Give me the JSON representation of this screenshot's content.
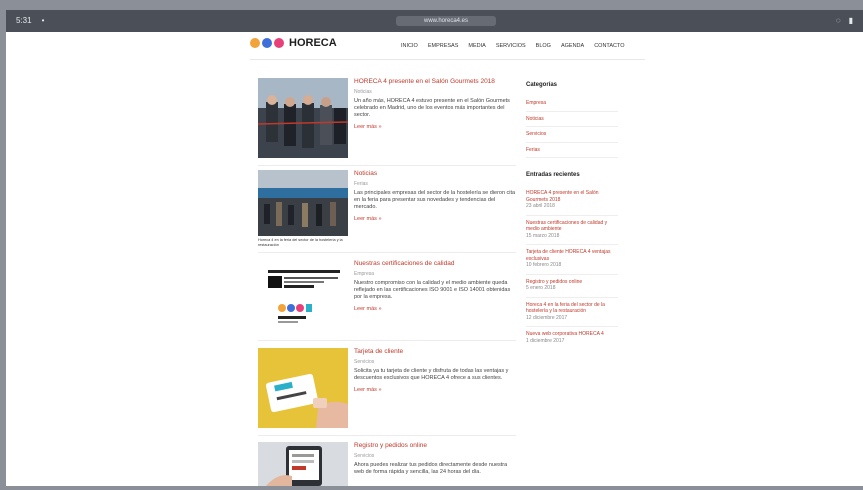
{
  "browser": {
    "left_labels": [
      "5:31",
      "•"
    ],
    "address": "www.horeca4.es",
    "right_icons": [
      "wifi-icon",
      "battery-icon"
    ]
  },
  "header": {
    "logo_text": "HORECA",
    "logo_sub": "",
    "nav": [
      "INICIO",
      "EMPRESAS",
      "MEDIA",
      "SERVICIOS",
      "BLOG",
      "AGENDA",
      "CONTACTO"
    ]
  },
  "articles": [
    {
      "title": "HORECA 4 presente en el Salón Gourmets 2018",
      "category": "Noticias",
      "text": "Un año más, HORECA 4 estuvo presente en el Salón Gourmets celebrado en Madrid, uno de los eventos más importantes del sector.",
      "more": "Leer más »",
      "caption": ""
    },
    {
      "title": "Noticias",
      "category": "Ferias",
      "text": "Las principales empresas del sector de la hostelería se dieron cita en la feria para presentar sus novedades y tendencias del mercado.",
      "more": "Leer más »",
      "caption": "Horeca 4 en la feria del sector de la hostelería y la restauración"
    },
    {
      "title": "Nuestras certificaciones de calidad",
      "category": "Empresa",
      "text": "Nuestro compromiso con la calidad y el medio ambiente queda reflejado en las certificaciones ISO 9001 e ISO 14001 obtenidas por la empresa.",
      "more": "Leer más »",
      "caption": ""
    },
    {
      "title": "Tarjeta de cliente",
      "category": "Servicios",
      "text": "Solicita ya tu tarjeta de cliente y disfruta de todas las ventajas y descuentos exclusivos que HORECA 4 ofrece a sus clientes.",
      "more": "Leer más »",
      "caption": ""
    },
    {
      "title": "Registro y pedidos online",
      "category": "Servicios",
      "text": "Ahora puedes realizar tus pedidos directamente desde nuestra web de forma rápida y sencilla, las 24 horas del día.",
      "more": "",
      "caption": ""
    }
  ],
  "sidebar": {
    "categories_title": "Categorías",
    "categories": [
      "Empresa",
      "Noticias",
      "Servicios",
      "Ferias"
    ],
    "recent_title": "Entradas recientes",
    "recent": [
      {
        "title": "HORECA 4 presente en el Salón Gourmets 2018",
        "date": "23 abril 2018"
      },
      {
        "title": "Nuestras certificaciones de calidad y medio ambiente",
        "date": "15 marzo 2018"
      },
      {
        "title": "Tarjeta de cliente HORECA 4 ventajas exclusivas",
        "date": "10 febrero 2018"
      },
      {
        "title": "Registro y pedidos online",
        "date": "5 enero 2018"
      },
      {
        "title": "Horeca 4 en la feria del sector de la hostelería y la restauración",
        "date": "12 diciembre 2017"
      },
      {
        "title": "Nueva web corporativa HORECA 4",
        "date": "1 diciembre 2017"
      }
    ]
  },
  "colors": {
    "accent": "#c0392b",
    "logo_dots": [
      "#f2a33a",
      "#3f6fd8",
      "#e8407a",
      "#2ab0c8"
    ]
  }
}
